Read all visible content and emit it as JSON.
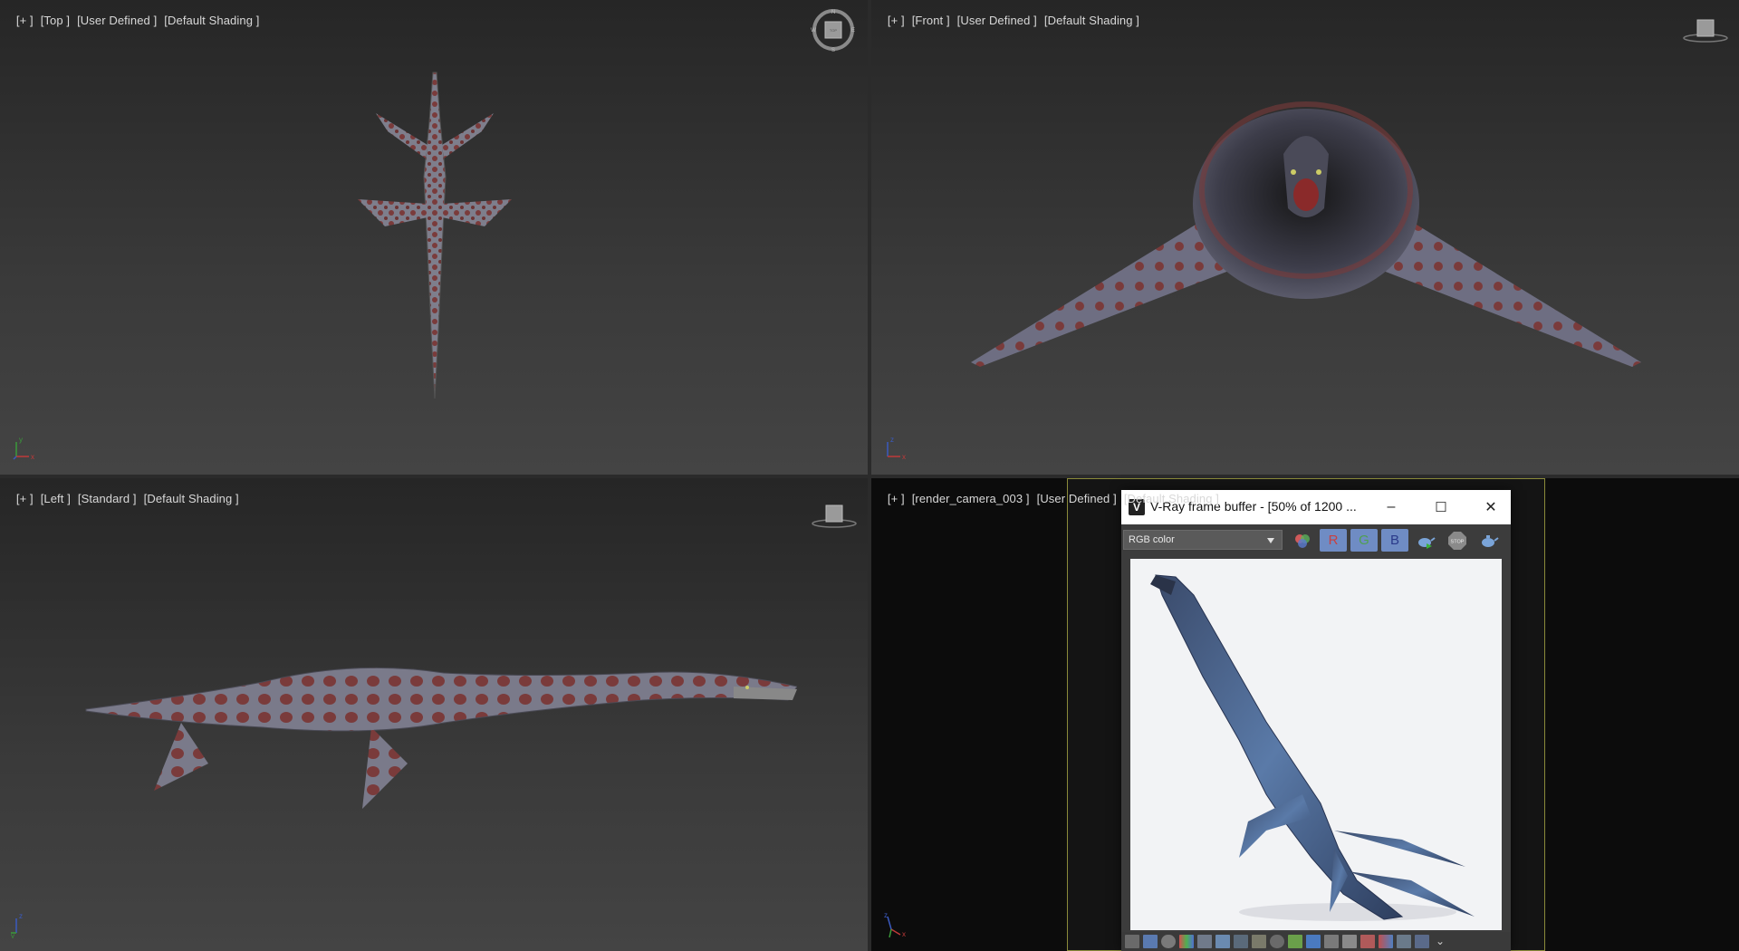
{
  "viewports": {
    "top": {
      "plus": "[+ ]",
      "view": "[Top ]",
      "style": "[User Defined ]",
      "shading": "[Default Shading ]"
    },
    "front": {
      "plus": "[+ ]",
      "view": "[Front ]",
      "style": "[User Defined ]",
      "shading": "[Default Shading ]"
    },
    "left": {
      "plus": "[+ ]",
      "view": "[Left ]",
      "style": "[Standard ]",
      "shading": "[Default Shading ]"
    },
    "camera": {
      "plus": "[+ ]",
      "view": "[render_camera_003 ]",
      "style": "[User Defined ]",
      "shading": "[Default Shading ]"
    }
  },
  "viewcube": {
    "n": "N",
    "s": "S",
    "e": "E",
    "w": "W",
    "face": "TOP"
  },
  "axis": {
    "x": "x",
    "y": "y",
    "z": "z"
  },
  "vfb": {
    "logo": "V",
    "title": "V-Ray frame buffer - [50% of 1200 ...",
    "channel": "RGB color",
    "r": "R",
    "g": "G",
    "b": "B",
    "stop": "STOP",
    "minimize": "–",
    "maximize": "☐",
    "close": "✕"
  },
  "colors": {
    "viewport_bg": "#333333",
    "channel_button": "#6f8cc4",
    "camera_frame": "#8a8a3a",
    "render_bg": "#f2f3f5"
  }
}
